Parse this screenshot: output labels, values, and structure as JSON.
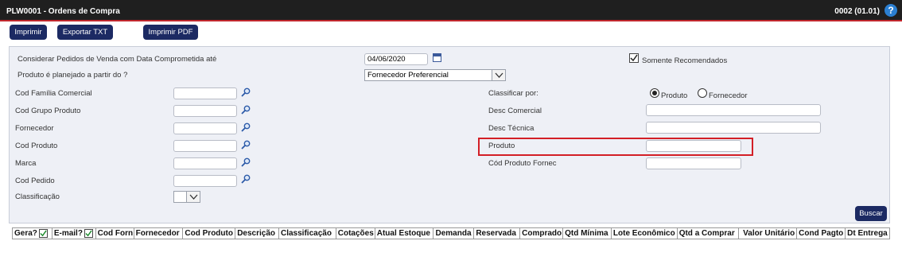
{
  "app": {
    "title": "PLW0001 - Ordens de Compra",
    "version": "0002 (01.01)"
  },
  "toolbar": {
    "print": "Imprimir",
    "export_txt": "Exportar TXT",
    "print_pdf": "Imprimir PDF"
  },
  "form": {
    "considerar_label": "Considerar Pedidos de Venda com Data Comprometida até",
    "data_value": "04/06/2020",
    "somente_recomendados": "Somente Recomendados",
    "somente_recomendados_checked": true,
    "produto_planejado_label": "Produto é planejado a partir do ?",
    "produto_planejado_value": "Fornecedor Preferencial",
    "cod_familia": "Cod Família Comercial",
    "cod_grupo": "Cod Grupo Produto",
    "fornecedor": "Fornecedor",
    "cod_produto": "Cod Produto",
    "marca": "Marca",
    "cod_pedido": "Cod Pedido",
    "classificacao": "Classificação",
    "classificar_por": "Classificar por:",
    "radio_produto": "Produto",
    "radio_fornecedor": "Fornecedor",
    "desc_comercial": "Desc Comercial",
    "desc_tecnica": "Desc Técnica",
    "produto": "Produto",
    "cod_produto_fornec": "Cód Produto Fornec",
    "buscar": "Buscar"
  },
  "grid": {
    "columns": [
      "Gera?",
      "E-mail?",
      "Cod Forn",
      "Fornecedor",
      "Cod Produto",
      "Descrição",
      "Classificação",
      "Cotações",
      "Atual Estoque",
      "Demanda",
      "Reservada",
      "Comprado",
      "Qtd Mínima",
      "Lote Econômico",
      "Qtd a Comprar",
      "Valor Unitário",
      "Cond Pagto",
      "Dt Entrega"
    ]
  },
  "icons": {
    "help": "help-icon",
    "lookup": "magnifier-icon",
    "calendar": "calendar-icon"
  },
  "colors": {
    "titlebar": "#1f1f1f",
    "accent_line": "#c1272d",
    "button": "#1c2a63",
    "highlight": "#d31f26",
    "panel": "#eef0f6"
  }
}
